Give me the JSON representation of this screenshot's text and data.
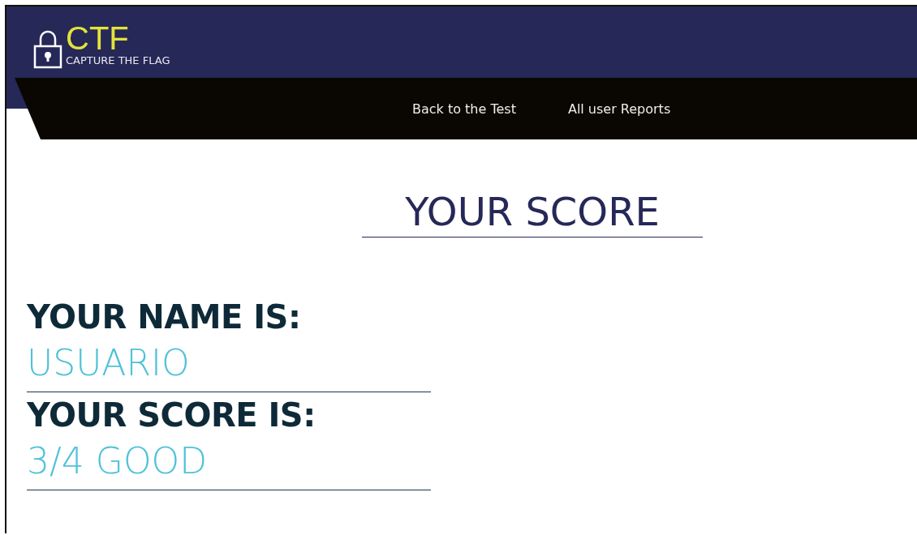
{
  "header": {
    "logo_title": "CTF",
    "logo_subtitle": "CAPTURE THE FLAG"
  },
  "nav": {
    "links": [
      {
        "label": "Back to the Test"
      },
      {
        "label": "All user Reports"
      }
    ]
  },
  "page_title": "YOUR SCORE",
  "fields": [
    {
      "label": "YOUR NAME IS:",
      "value": "USUARIO"
    },
    {
      "label": "YOUR SCORE IS:",
      "value": "3/4 GOOD"
    }
  ]
}
